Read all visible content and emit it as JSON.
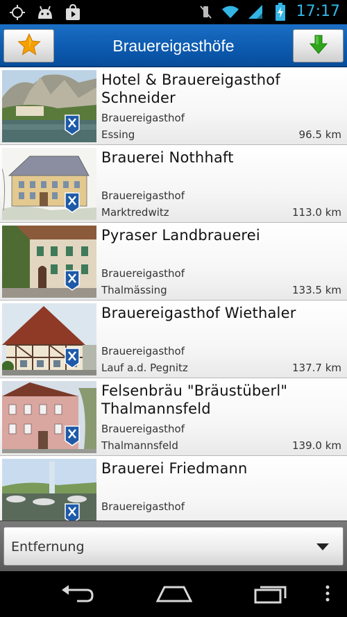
{
  "status_bar": {
    "time": "17:17",
    "icons": [
      "gps-icon",
      "android-icon",
      "play-store-icon",
      "mute-icon",
      "wifi-icon",
      "signal-icon",
      "battery-charging-icon"
    ]
  },
  "action_bar": {
    "title": "Brauereigasthöfe",
    "left_icon": "star-icon",
    "right_icon": "download-arrow-icon"
  },
  "list": {
    "items": [
      {
        "name": "Hotel & Brauereigasthof Schneider",
        "category": "Brauereigasthof",
        "location": "Essing",
        "distance": "96.5 km"
      },
      {
        "name": "Brauerei Nothhaft",
        "category": "Brauereigasthof",
        "location": "Marktredwitz",
        "distance": "113.0 km"
      },
      {
        "name": "Pyraser Landbrauerei",
        "category": "Brauereigasthof",
        "location": "Thalmässing",
        "distance": "133.5 km"
      },
      {
        "name": "Brauereigasthof Wiethaler",
        "category": "Brauereigasthof",
        "location": "Lauf a.d. Pegnitz",
        "distance": "137.7 km"
      },
      {
        "name": "Felsenbräu \"Bräustüberl\" Thalmannsfeld",
        "category": "Brauereigasthof",
        "location": "Thalmannsfeld",
        "distance": "139.0 km"
      },
      {
        "name": "Brauerei Friedmann",
        "category": "Brauereigasthof",
        "location": "",
        "distance": ""
      }
    ]
  },
  "filter": {
    "selected": "Entfernung"
  },
  "nav_bar": {
    "icons": [
      "back-icon",
      "home-icon",
      "recent-apps-icon",
      "menu-icon"
    ]
  },
  "colors": {
    "action_bar": "#0d5bb0",
    "status_accent": "#33b5e5",
    "star": "#f5a000",
    "arrow": "#2fa51c"
  }
}
